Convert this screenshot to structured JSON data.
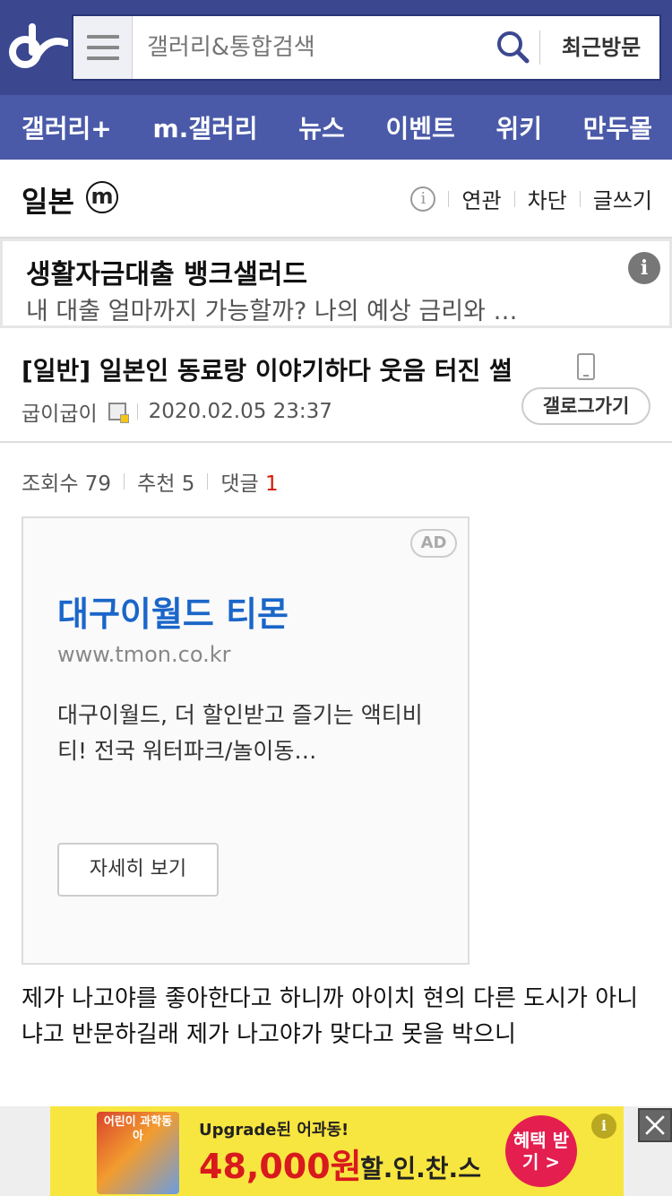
{
  "header": {
    "search_placeholder": "갤러리&통합검색",
    "recent_label": "최근방문"
  },
  "nav": {
    "items": [
      "갤러리+",
      "m.갤러리",
      "뉴스",
      "이벤트",
      "위키",
      "만두몰"
    ]
  },
  "gallery": {
    "title": "일본",
    "mark": "m",
    "actions": [
      "연관",
      "차단",
      "글쓰기"
    ]
  },
  "text_ad": {
    "title": "생활자금대출 뱅크샐러드",
    "desc": "내 대출 얼마까지 가능할까? 나의 예상 금리와 …"
  },
  "post": {
    "title": "[일반] 일본인 동료랑 이야기하다 웃음 터진 썰",
    "author": "굽이굽이",
    "date": "2020.02.05 23:37",
    "gallery_go": "갤로그가기",
    "views_label": "조회수",
    "views": "79",
    "recommend_label": "추천",
    "recommend": "5",
    "comments_label": "댓글",
    "comments": "1",
    "body": "제가 나고야를 좋아한다고 하니까 아이치 현의 다른 도시가 아니냐고 반문하길래 제가 나고야가 맞다고 못을 박으니"
  },
  "display_ad": {
    "badge": "AD",
    "title": "대구이월드 티몬",
    "url": "www.tmon.co.kr",
    "desc": "대구이월드, 더 할인받고 즐기는 액티비티! 전국 워터파크/놀이동…",
    "more": "자세히 보기"
  },
  "banner": {
    "book_title": "어린이 과학동아",
    "upgrade": "Upgrade된 어과동!",
    "price": "48,000원",
    "chance": "할.인.찬.스",
    "cta": "혜택 받기 >"
  },
  "colors": {
    "header_bg": "#3b4890",
    "nav_bg": "#4a5aa8",
    "ad_title": "#1a66c9",
    "comment_count": "#d31900",
    "banner_bg": "#f8e640"
  }
}
